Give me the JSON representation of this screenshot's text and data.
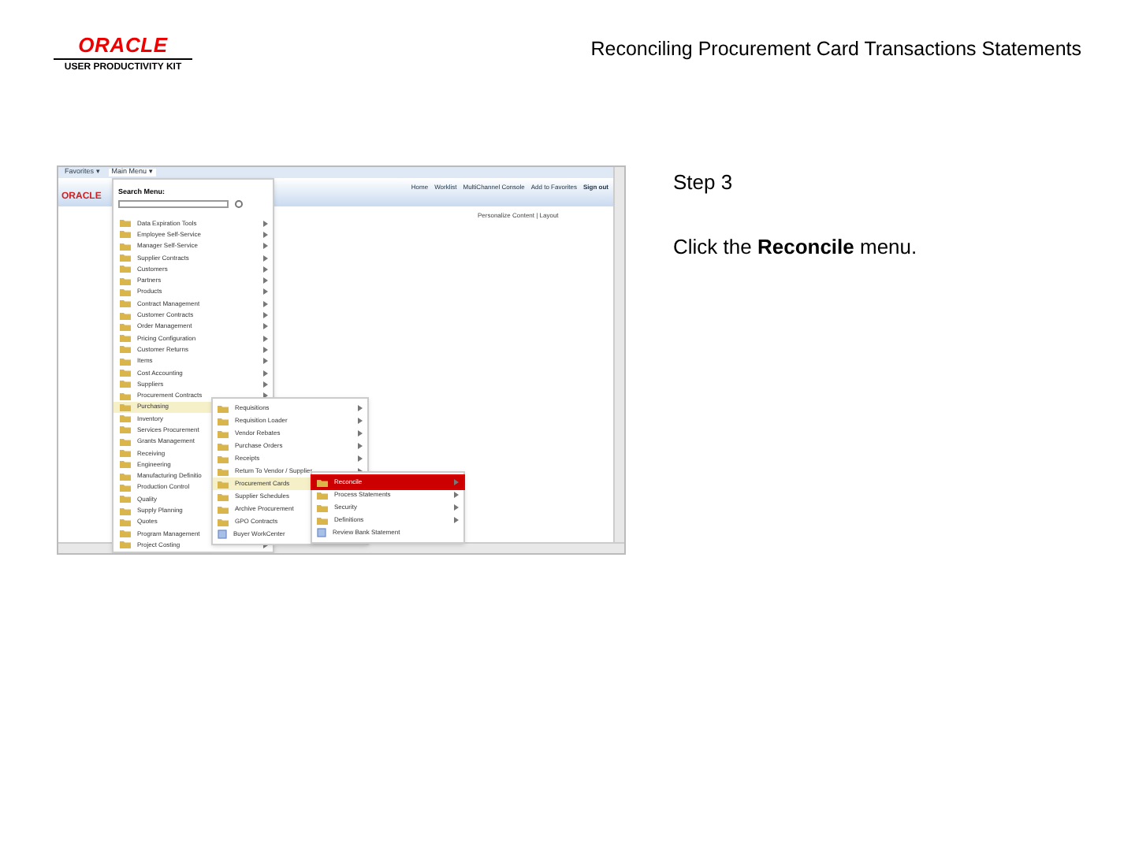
{
  "header": {
    "logo": "ORACLE",
    "logo_subtitle": "USER PRODUCTIVITY KIT",
    "title": "Reconciling Procurement Card Transactions Statements"
  },
  "screenshot": {
    "nav_tabs": [
      {
        "label": "Favorites ▾",
        "selected": false
      },
      {
        "label": "Main Menu ▾",
        "selected": true
      }
    ],
    "brand": "ORACLE",
    "search_label": "Search Menu:",
    "header_links": [
      "Home",
      "Worklist",
      "MultiChannel Console",
      "Add to Favorites",
      "Sign out"
    ],
    "personalize": "Personalize Content | Layout",
    "main_menu": [
      {
        "label": "Data Expiration Tools",
        "has_submenu": true,
        "selected": false
      },
      {
        "label": "Employee Self-Service",
        "has_submenu": true,
        "selected": false
      },
      {
        "label": "Manager Self-Service",
        "has_submenu": true,
        "selected": false
      },
      {
        "label": "Supplier Contracts",
        "has_submenu": true,
        "selected": false
      },
      {
        "label": "Customers",
        "has_submenu": true,
        "selected": false
      },
      {
        "label": "Partners",
        "has_submenu": true,
        "selected": false
      },
      {
        "label": "Products",
        "has_submenu": true,
        "selected": false
      },
      {
        "label": "Contract Management",
        "has_submenu": true,
        "selected": false
      },
      {
        "label": "Customer Contracts",
        "has_submenu": true,
        "selected": false
      },
      {
        "label": "Order Management",
        "has_submenu": true,
        "selected": false
      },
      {
        "label": "Pricing Configuration",
        "has_submenu": true,
        "selected": false
      },
      {
        "label": "Customer Returns",
        "has_submenu": true,
        "selected": false
      },
      {
        "label": "Items",
        "has_submenu": true,
        "selected": false
      },
      {
        "label": "Cost Accounting",
        "has_submenu": true,
        "selected": false
      },
      {
        "label": "Suppliers",
        "has_submenu": true,
        "selected": false
      },
      {
        "label": "Procurement Contracts",
        "has_submenu": true,
        "selected": false
      },
      {
        "label": "Purchasing",
        "has_submenu": true,
        "selected": true
      },
      {
        "label": "Inventory",
        "has_submenu": true,
        "selected": false
      },
      {
        "label": "Services Procurement",
        "has_submenu": true,
        "selected": false
      },
      {
        "label": "Grants Management",
        "has_submenu": true,
        "selected": false
      },
      {
        "label": "Receiving",
        "has_submenu": true,
        "selected": false
      },
      {
        "label": "Engineering",
        "has_submenu": true,
        "selected": false
      },
      {
        "label": "Manufacturing Definitio",
        "has_submenu": true,
        "selected": false
      },
      {
        "label": "Production Control",
        "has_submenu": true,
        "selected": false
      },
      {
        "label": "Quality",
        "has_submenu": true,
        "selected": false
      },
      {
        "label": "Supply Planning",
        "has_submenu": true,
        "selected": false
      },
      {
        "label": "Quotes",
        "has_submenu": true,
        "selected": false
      },
      {
        "label": "Program Management",
        "has_submenu": true,
        "selected": false
      },
      {
        "label": "Project Costing",
        "has_submenu": true,
        "selected": false
      }
    ],
    "submenu": [
      {
        "label": "Requisitions",
        "kind": "folder",
        "selected": false
      },
      {
        "label": "Requisition Loader",
        "kind": "folder",
        "selected": false
      },
      {
        "label": "Vendor Rebates",
        "kind": "folder",
        "selected": false
      },
      {
        "label": "Purchase Orders",
        "kind": "folder",
        "selected": false
      },
      {
        "label": "Receipts",
        "kind": "folder",
        "selected": false
      },
      {
        "label": "Return To Vendor / Supplier",
        "kind": "folder",
        "selected": false
      },
      {
        "label": "Procurement Cards",
        "kind": "folder",
        "selected": true
      },
      {
        "label": "Supplier Schedules",
        "kind": "folder",
        "selected": false
      },
      {
        "label": "Archive Procurement",
        "kind": "folder",
        "selected": false
      },
      {
        "label": "GPO Contracts",
        "kind": "folder",
        "selected": false
      },
      {
        "label": "Buyer WorkCenter",
        "kind": "page",
        "selected": false
      }
    ],
    "subsubmenu": [
      {
        "label": "Reconcile",
        "kind": "folder",
        "selected": true
      },
      {
        "label": "Process Statements",
        "kind": "folder",
        "selected": false
      },
      {
        "label": "Security",
        "kind": "folder",
        "selected": false
      },
      {
        "label": "Definitions",
        "kind": "folder",
        "selected": false
      },
      {
        "label": "Review Bank Statement",
        "kind": "page",
        "selected": false
      }
    ]
  },
  "instruction": {
    "step": "Step 3",
    "text": "Click the **Reconcile** menu."
  }
}
